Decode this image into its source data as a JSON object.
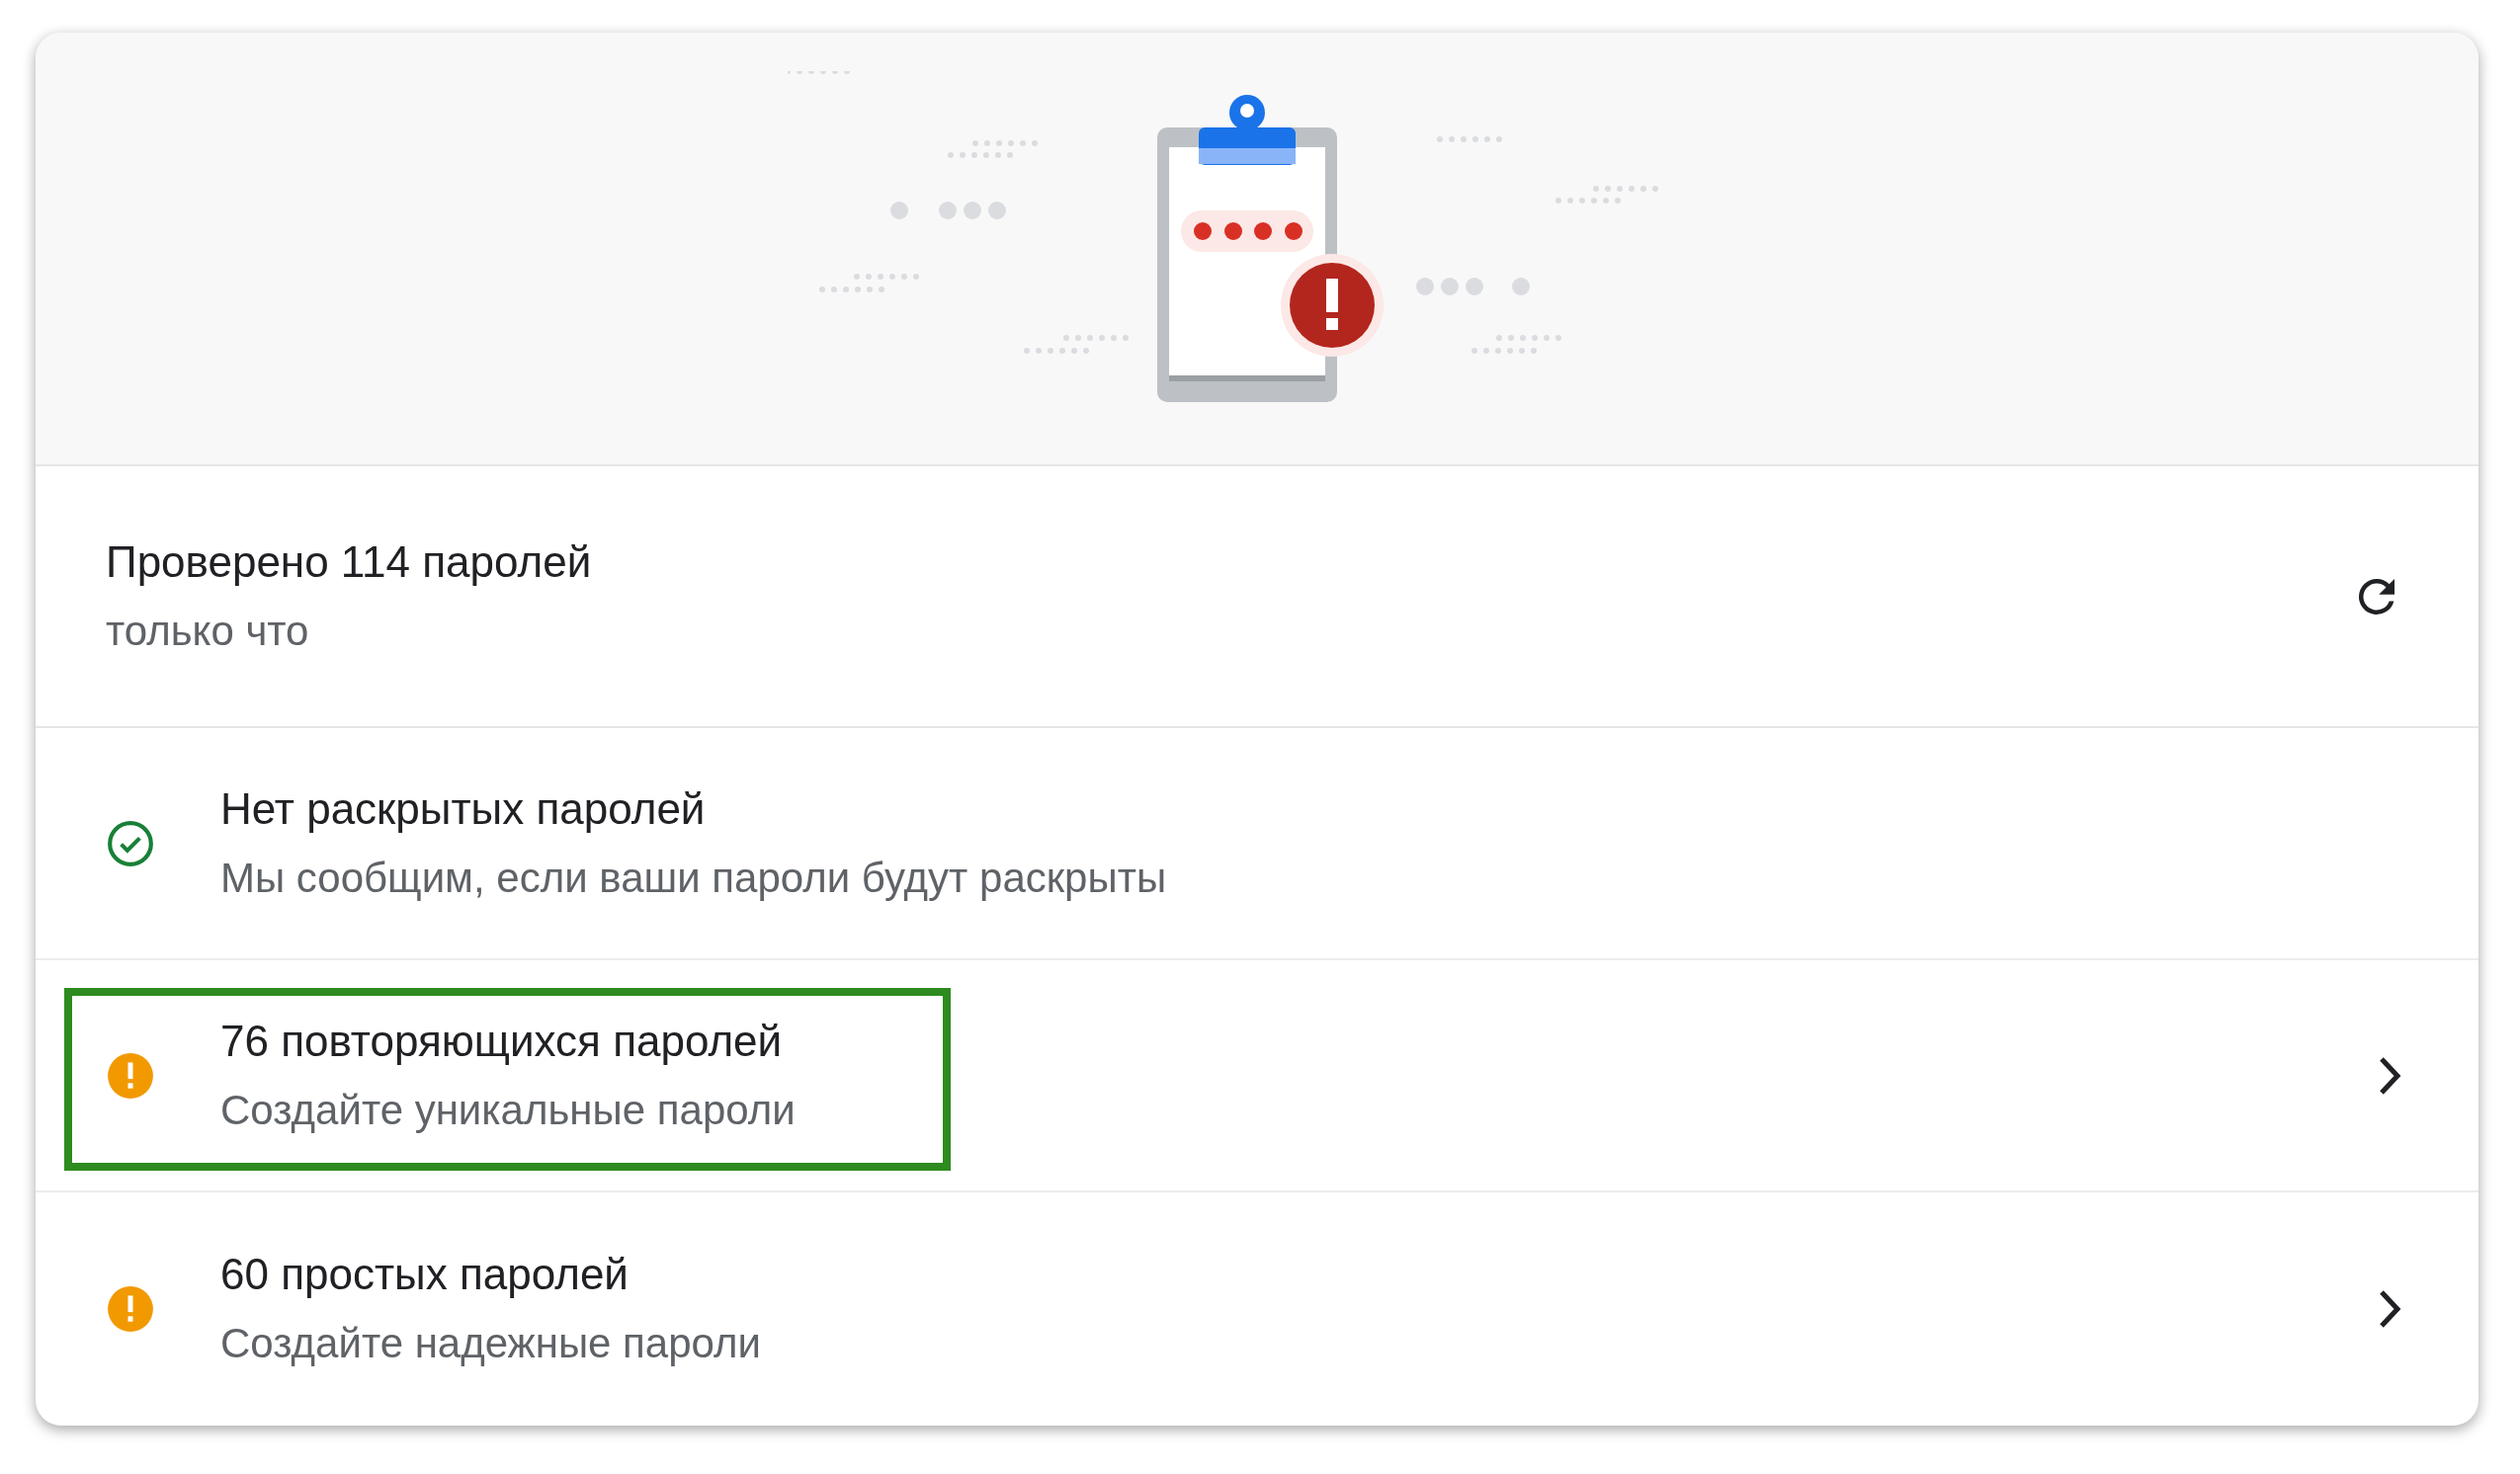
{
  "summary": {
    "title": "Проверено 114 паролей",
    "subtitle": "только что"
  },
  "items": [
    {
      "kind": "ok",
      "title": "Нет раскрытых паролей",
      "subtitle": "Мы сообщим, если ваши пароли будут раскрыты",
      "navigable": false,
      "highlighted": false
    },
    {
      "kind": "warning",
      "title": "76 повторяющихся паролей",
      "subtitle": "Создайте уникальные пароли",
      "navigable": true,
      "highlighted": true
    },
    {
      "kind": "warning",
      "title": "60 простых паролей",
      "subtitle": "Создайте надежные пароли",
      "navigable": true,
      "highlighted": false
    }
  ]
}
